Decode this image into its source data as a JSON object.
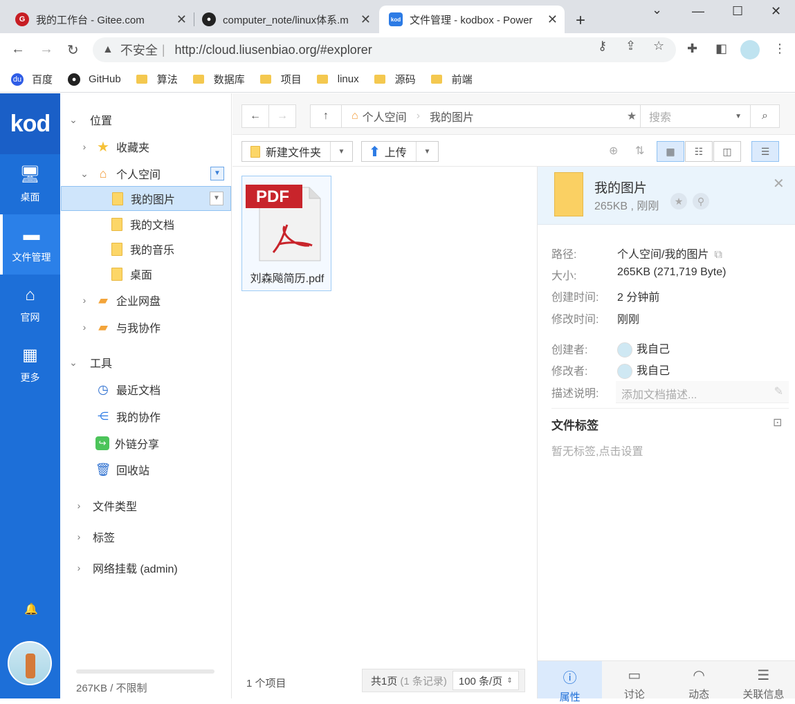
{
  "browser": {
    "tabs": [
      {
        "title": "我的工作台 - Gitee.com",
        "icon": "gitee-icon"
      },
      {
        "title": "computer_note/linux体系.m",
        "icon": "github-icon"
      },
      {
        "title": "文件管理 - kodbox - Power",
        "icon": "kodbox-icon"
      }
    ],
    "insecure_label": "不安全",
    "url": "http://cloud.liusenbiao.org/#explorer",
    "bookmarks": [
      {
        "label": "百度",
        "icon": "baidu-icon"
      },
      {
        "label": "GitHub",
        "icon": "github-icon"
      },
      {
        "label": "算法",
        "icon": "folder-icon"
      },
      {
        "label": "数据库",
        "icon": "folder-icon"
      },
      {
        "label": "项目",
        "icon": "folder-icon"
      },
      {
        "label": "linux",
        "icon": "folder-icon"
      },
      {
        "label": "源码",
        "icon": "folder-icon"
      },
      {
        "label": "前端",
        "icon": "folder-icon"
      }
    ]
  },
  "leftnav": {
    "logo": "kod",
    "items": [
      {
        "label": "桌面",
        "icon": "desktop-icon"
      },
      {
        "label": "文件管理",
        "icon": "folder-icon"
      },
      {
        "label": "官网",
        "icon": "home-icon"
      },
      {
        "label": "更多",
        "icon": "grid-icon"
      }
    ]
  },
  "tree": {
    "location": "位置",
    "favorites": "收藏夹",
    "personal": "个人空间",
    "children": [
      "我的图片",
      "我的文档",
      "我的音乐",
      "桌面"
    ],
    "enterprise": "企业网盘",
    "shared": "与我协作",
    "tools": "工具",
    "tool_items": [
      "最近文档",
      "我的协作",
      "外链分享",
      "回收站"
    ],
    "filetype": "文件类型",
    "tags": "标签",
    "mount": "网络挂载 (admin)",
    "quota": "267KB / 不限制"
  },
  "toolbar": {
    "breadcrumb": [
      "个人空间",
      "我的图片"
    ],
    "search_placeholder": "搜索",
    "new_folder": "新建文件夹",
    "upload": "上传"
  },
  "files": [
    {
      "name": "刘森飚简历.pdf",
      "type": "pdf",
      "label": "PDF"
    }
  ],
  "status": {
    "count": "1 个项目",
    "pages": "共1页",
    "records": "(1 条记录)",
    "per_page": "100 条/页"
  },
  "panel": {
    "title": "我的图片",
    "subtitle": "265KB , 刚刚",
    "props": [
      {
        "label": "路径:",
        "value": "个人空间/我的图片"
      },
      {
        "label": "大小:",
        "value": "265KB (271,719 Byte)"
      },
      {
        "label": "创建时间:",
        "value": "2 分钟前"
      },
      {
        "label": "修改时间:",
        "value": "刚刚"
      },
      {
        "label": "创建者:",
        "value": "我自己"
      },
      {
        "label": "修改者:",
        "value": "我自己"
      },
      {
        "label": "描述说明:",
        "value": "添加文档描述..."
      }
    ],
    "tags_title": "文件标签",
    "tags_empty": "暂无标签,点击设置",
    "tabs": [
      "属性",
      "讨论",
      "动态",
      "关联信息"
    ]
  }
}
